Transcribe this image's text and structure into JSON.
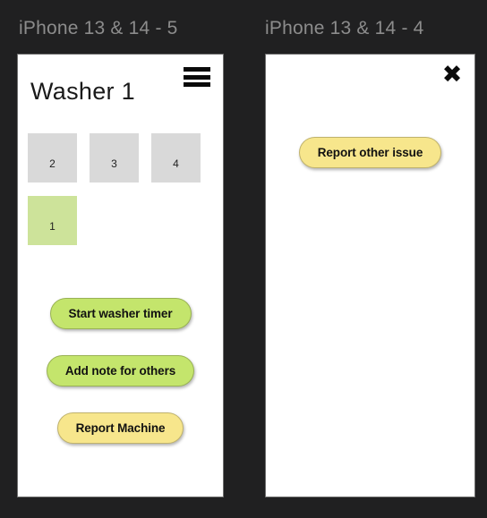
{
  "background_color": "#202021",
  "frames": [
    {
      "id": "washer",
      "label": "iPhone 13 & 14 - 5",
      "menu_icon": "hamburger-icon",
      "title": "Washer 1",
      "tiles": [
        {
          "label": "2",
          "selected": false
        },
        {
          "label": "3",
          "selected": false
        },
        {
          "label": "4",
          "selected": false
        },
        {
          "label": "1",
          "selected": true
        }
      ],
      "actions": [
        {
          "label": "Start washer timer",
          "color": "green"
        },
        {
          "label": "Add note for others",
          "color": "green"
        },
        {
          "label": "Report Machine",
          "color": "yellow"
        }
      ]
    },
    {
      "id": "report",
      "label": "iPhone 13 & 14 - 4",
      "close_icon": "close-icon",
      "actions": [
        {
          "label": "Report other issue",
          "color": "yellow"
        }
      ]
    }
  ],
  "colors": {
    "tile_default": "#d9d9d9",
    "tile_selected": "#cde39a",
    "pill_green": "#c4e56c",
    "pill_yellow": "#f7e68c",
    "label_gray": "#8c8c8c"
  }
}
